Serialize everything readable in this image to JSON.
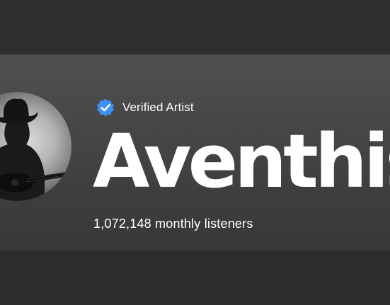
{
  "artist": {
    "verified_label": "Verified Artist",
    "name": "Aventhis",
    "monthly_listeners": "1,072,148 monthly listeners",
    "verified_icon": "verified-badge-icon"
  },
  "colors": {
    "verified_badge": "#3d91f4",
    "text": "#ffffff"
  }
}
